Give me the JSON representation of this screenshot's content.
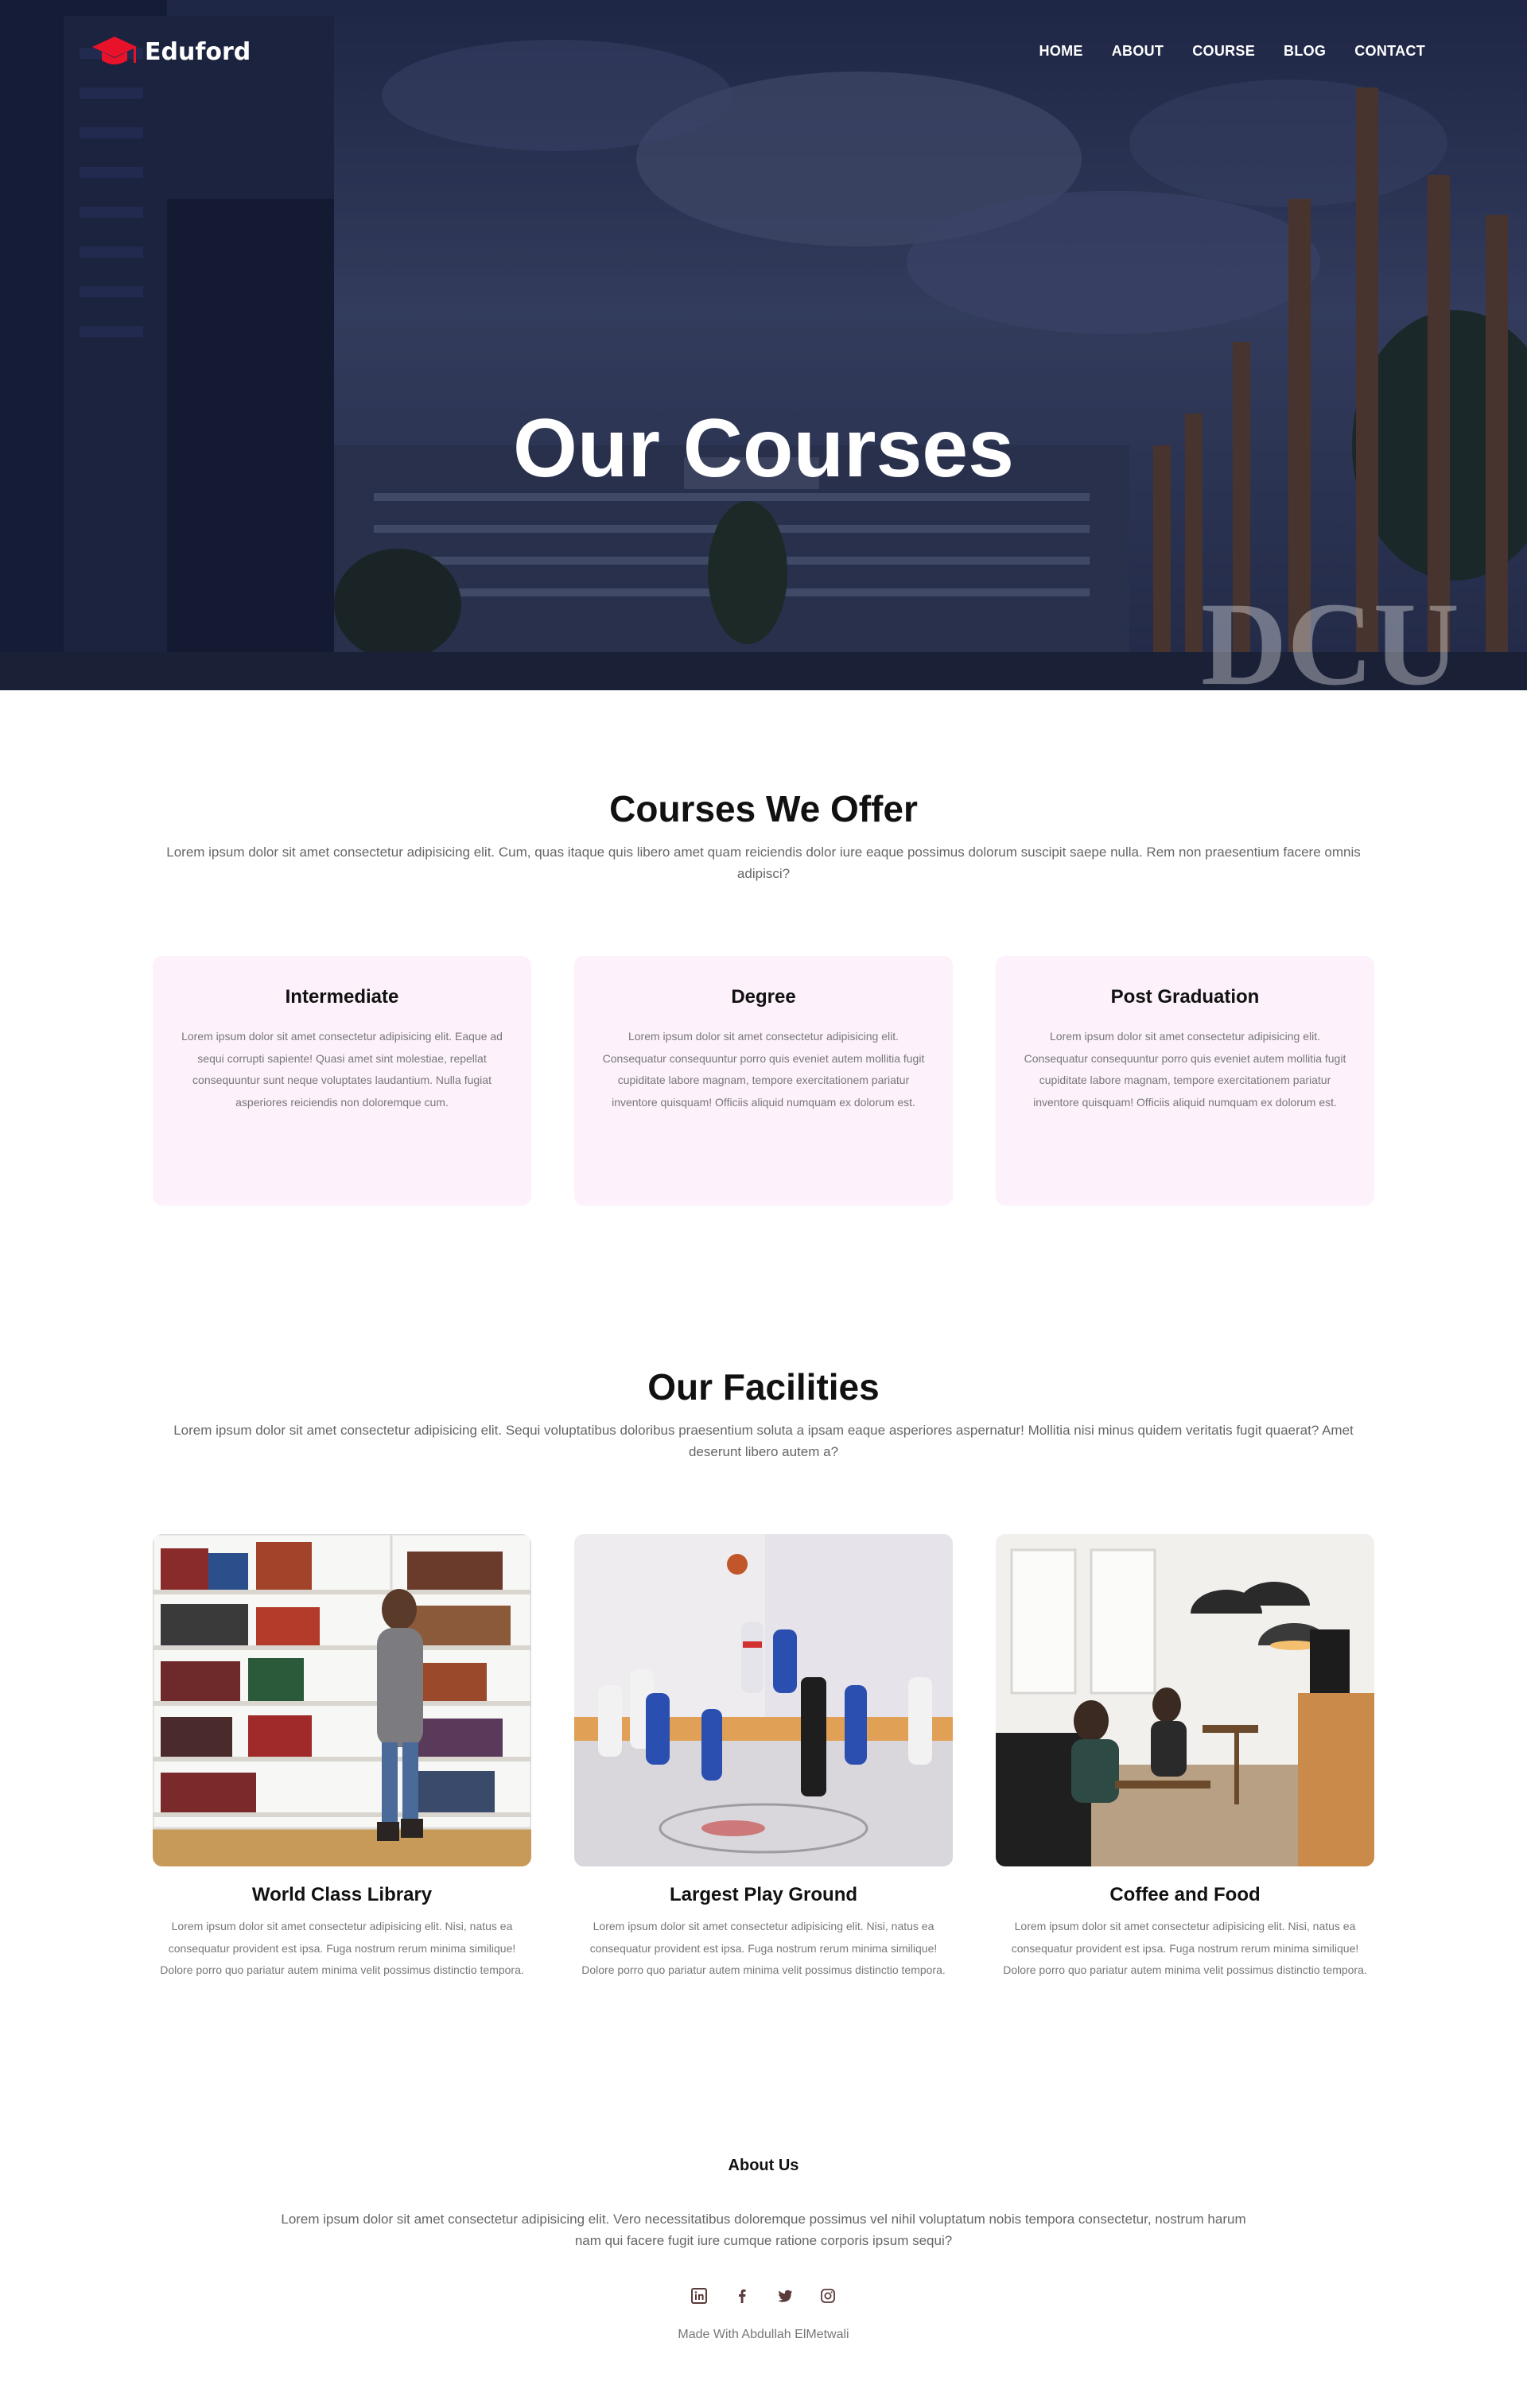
{
  "brand": {
    "name": "Eduford",
    "accent": "#e8132b"
  },
  "nav": {
    "items": [
      "HOME",
      "ABOUT",
      "COURSE",
      "BLOG",
      "CONTACT"
    ]
  },
  "hero": {
    "title": "Our Courses",
    "watermark": "DCU"
  },
  "courses": {
    "title": "Courses We Offer",
    "subtitle": "Lorem ipsum dolor sit amet consectetur adipisicing elit. Cum, quas itaque quis libero amet quam reiciendis dolor iure eaque possimus dolorum suscipit saepe nulla. Rem non praesentium facere omnis adipisci?",
    "cards": [
      {
        "title": "Intermediate",
        "text": "Lorem ipsum dolor sit amet consectetur adipisicing elit. Eaque ad sequi corrupti sapiente! Quasi amet sint molestiae, repellat consequuntur sunt neque voluptates laudantium. Nulla fugiat asperiores reiciendis non doloremque cum."
      },
      {
        "title": "Degree",
        "text": "Lorem ipsum dolor sit amet consectetur adipisicing elit. Consequatur consequuntur porro quis eveniet autem mollitia fugit cupiditate labore magnam, tempore exercitationem pariatur inventore quisquam! Officiis aliquid numquam ex dolorum est."
      },
      {
        "title": "Post Graduation",
        "text": "Lorem ipsum dolor sit amet consectetur adipisicing elit. Consequatur consequuntur porro quis eveniet autem mollitia fugit cupiditate labore magnam, tempore exercitationem pariatur inventore quisquam! Officiis aliquid numquam ex dolorum est."
      }
    ],
    "card_bg": "#fdf1fc"
  },
  "facilities": {
    "title": "Our Facilities",
    "subtitle": "Lorem ipsum dolor sit amet consectetur adipisicing elit. Sequi voluptatibus doloribus praesentium soluta a ipsam eaque asperiores aspernatur! Mollitia nisi minus quidem veritatis fugit quaerat? Amet deserunt libero autem a?",
    "cards": [
      {
        "title": "World Class Library",
        "image": "library",
        "text": "Lorem ipsum dolor sit amet consectetur adipisicing elit. Nisi, natus ea consequatur provident est ipsa. Fuga nostrum rerum minima similique! Dolore porro quo pariatur autem minima velit possimus distinctio tempora."
      },
      {
        "title": "Largest Play Ground",
        "image": "basketball-court",
        "text": "Lorem ipsum dolor sit amet consectetur adipisicing elit. Nisi, natus ea consequatur provident est ipsa. Fuga nostrum rerum minima similique! Dolore porro quo pariatur autem minima velit possimus distinctio tempora."
      },
      {
        "title": "Coffee and Food",
        "image": "cafe",
        "text": "Lorem ipsum dolor sit amet consectetur adipisicing elit. Nisi, natus ea consequatur provident est ipsa. Fuga nostrum rerum minima similique! Dolore porro quo pariatur autem minima velit possimus distinctio tempora."
      }
    ]
  },
  "about": {
    "title": "About Us",
    "text": "Lorem ipsum dolor sit amet consectetur adipisicing elit. Vero necessitatibus doloremque possimus vel nihil voluptatum nobis tempora consectetur, nostrum harum nam qui facere fugit iure cumque ratione corporis ipsum sequi?",
    "socials": [
      "linkedin-icon",
      "facebook-icon",
      "twitter-icon",
      "instagram-icon"
    ],
    "credit": "Made With Abdullah ElMetwali"
  }
}
